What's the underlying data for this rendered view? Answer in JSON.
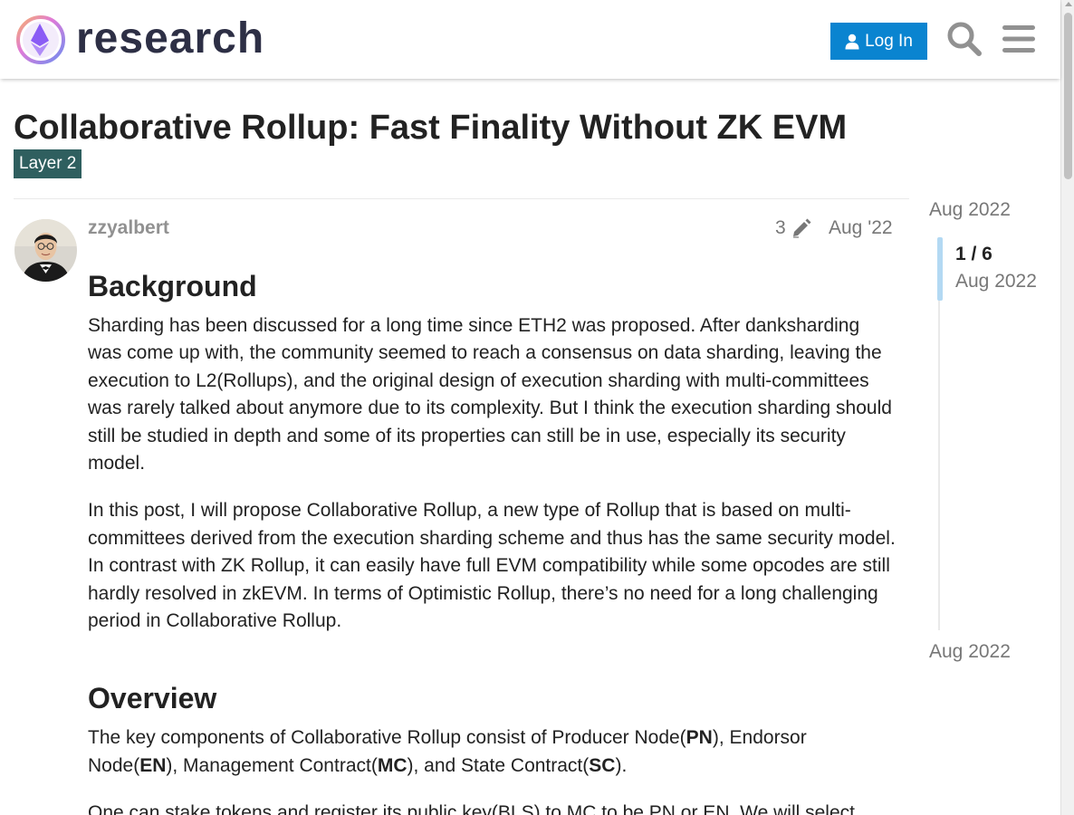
{
  "header": {
    "logo_text": "research",
    "login_label": "Log In",
    "search_icon": "search-icon",
    "menu_icon": "hamburger-menu-icon"
  },
  "topic": {
    "title": "Collaborative Rollup: Fast Finality Without ZK EVM",
    "category": "Layer 2",
    "category_color": "#2f5f5f"
  },
  "post": {
    "username": "zzyalbert",
    "edit_count": "3",
    "date": "Aug '22",
    "heading_1": "Background",
    "para_1": "Sharding has been discussed for a long time since ETH2 was proposed. After danksharding was come up with, the community seemed to reach a consensus on data sharding, leaving the execution to L2(Rollups), and the original design of execution sharding with multi-committees was rarely talked about anymore due to its complexity. But I think the execution sharding should still be studied in depth and some of its properties can still be in use, especially its security model.",
    "para_2": "In this post, I will propose Collaborative Rollup, a new type of Rollup that is based on multi-committees derived from the execution sharding scheme and thus has the same security model. In contrast with ZK Rollup, it can easily have full EVM compatibility while some opcodes are still hardly resolved in zkEVM. In terms of Optimistic Rollup, there’s no need for a long challenging period in Collaborative Rollup.",
    "heading_2": "Overview",
    "para_3": {
      "t1": "The key components of Collaborative Rollup consist of Producer Node(",
      "b1": "PN",
      "t2": "), Endorsor Node(",
      "b2": "EN",
      "t3": "), Management Contract(",
      "b3": "MC",
      "t4": "), and State Contract(",
      "b4": "SC",
      "t5": ")."
    },
    "para_4": "One can stake tokens and register its public key(BLS) to MC to be PN or EN. We will select"
  },
  "timeline": {
    "top_date": "Aug 2022",
    "position": "1 / 6",
    "position_date": "Aug 2022",
    "bottom_date": "Aug 2022"
  },
  "colors": {
    "accent": "#0a84d0",
    "timeline_handle": "#b3d9f3"
  }
}
